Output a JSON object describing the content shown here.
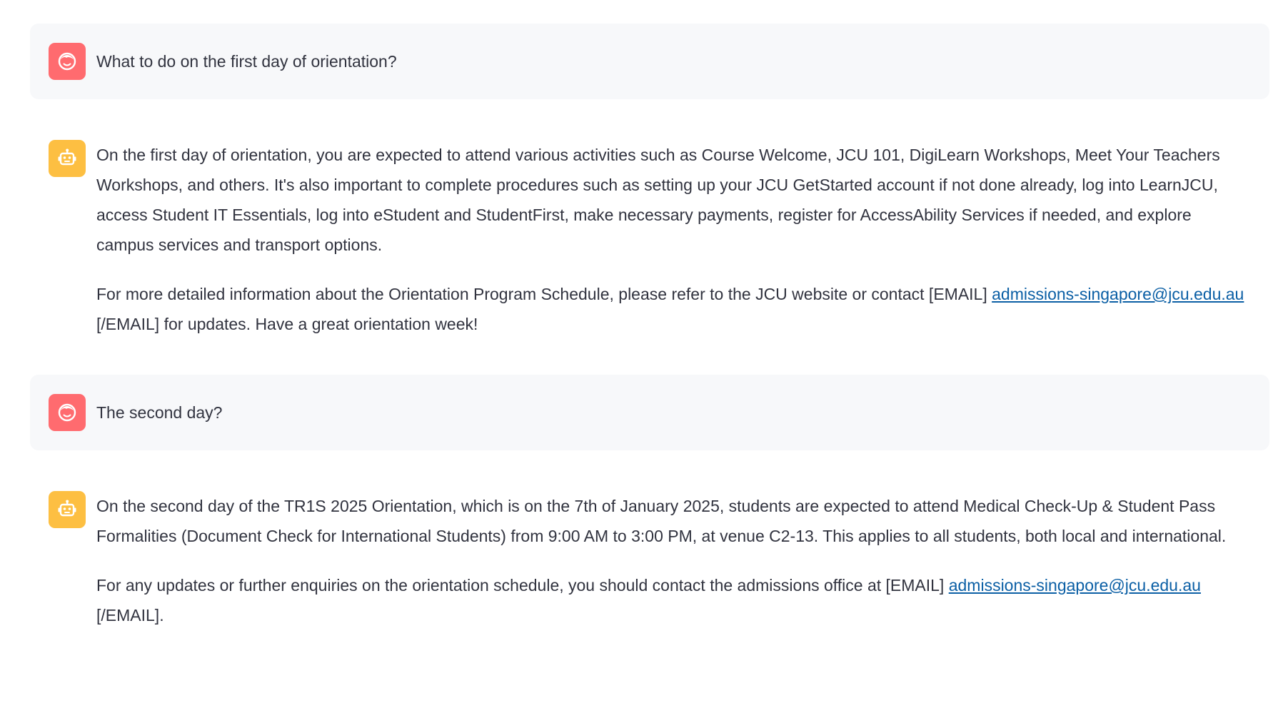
{
  "messages": [
    {
      "role": "user",
      "avatar_icon": "user-face-icon",
      "text": "What to do on the first day of orientation?"
    },
    {
      "role": "assistant",
      "avatar_icon": "robot-icon",
      "p1": "On the first day of orientation, you are expected to attend various activities such as Course Welcome, JCU 101, DigiLearn Workshops, Meet Your Teachers Workshops, and others. It's also important to complete procedures such as setting up your JCU GetStarted account if not done already, log into LearnJCU, access Student IT Essentials, log into eStudent and StudentFirst, make necessary payments, register for AccessAbility Services if needed, and explore campus services and transport options.",
      "p2_before": "For more detailed information about the Orientation Program Schedule, please refer to the JCU website or contact [EMAIL] ",
      "p2_link": "admissions-singapore@jcu.edu.au",
      "p2_after": " [/EMAIL] for updates. Have a great orientation week!"
    },
    {
      "role": "user",
      "avatar_icon": "user-face-icon",
      "text": "The second day?"
    },
    {
      "role": "assistant",
      "avatar_icon": "robot-icon",
      "p1": "On the second day of the TR1S 2025 Orientation, which is on the 7th of January 2025, students are expected to attend Medical Check-Up & Student Pass Formalities (Document Check for International Students) from 9:00 AM to 3:00 PM, at venue C2-13. This applies to all students, both local and international.",
      "p2_before": "For any updates or further enquiries on the orientation schedule, you should contact the admissions office at [EMAIL] ",
      "p2_link": "admissions-singapore@jcu.edu.au",
      "p2_after": " [/EMAIL]."
    }
  ],
  "colors": {
    "user_avatar_bg": "#ff6b6f",
    "assistant_avatar_bg": "#fdbf42",
    "user_bubble_bg": "#f7f8fa",
    "link": "#0b5fa5",
    "text": "#31333f"
  }
}
